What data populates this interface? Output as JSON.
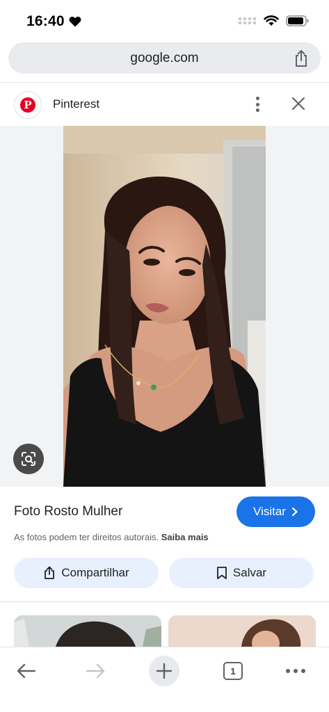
{
  "status": {
    "time": "16:40"
  },
  "address_bar": {
    "url": "google.com"
  },
  "source": {
    "favicon_letter": "P",
    "name": "Pinterest"
  },
  "result": {
    "title": "Foto Rosto Mulher",
    "visit_label": "Visitar",
    "copyright_text": "As fotos podem ter direitos autorais.",
    "learn_more": "Saiba mais",
    "share_label": "Compartilhar",
    "save_label": "Salvar"
  },
  "toolbar": {
    "tab_count": "1"
  },
  "icons": {
    "status": [
      "heart-icon",
      "cellular-signal-icon",
      "wifi-icon",
      "battery-icon"
    ],
    "address": [
      "share-icon"
    ],
    "header": [
      "more-vertical-icon",
      "close-icon"
    ],
    "image": [
      "lens-search-icon"
    ],
    "toolbar": [
      "back-arrow-icon",
      "forward-arrow-icon",
      "plus-icon",
      "tabs-icon",
      "more-horizontal-icon"
    ]
  },
  "colors": {
    "accent": "#1a73e8",
    "pill": "#e8f0fe",
    "pinterest": "#e60023"
  }
}
